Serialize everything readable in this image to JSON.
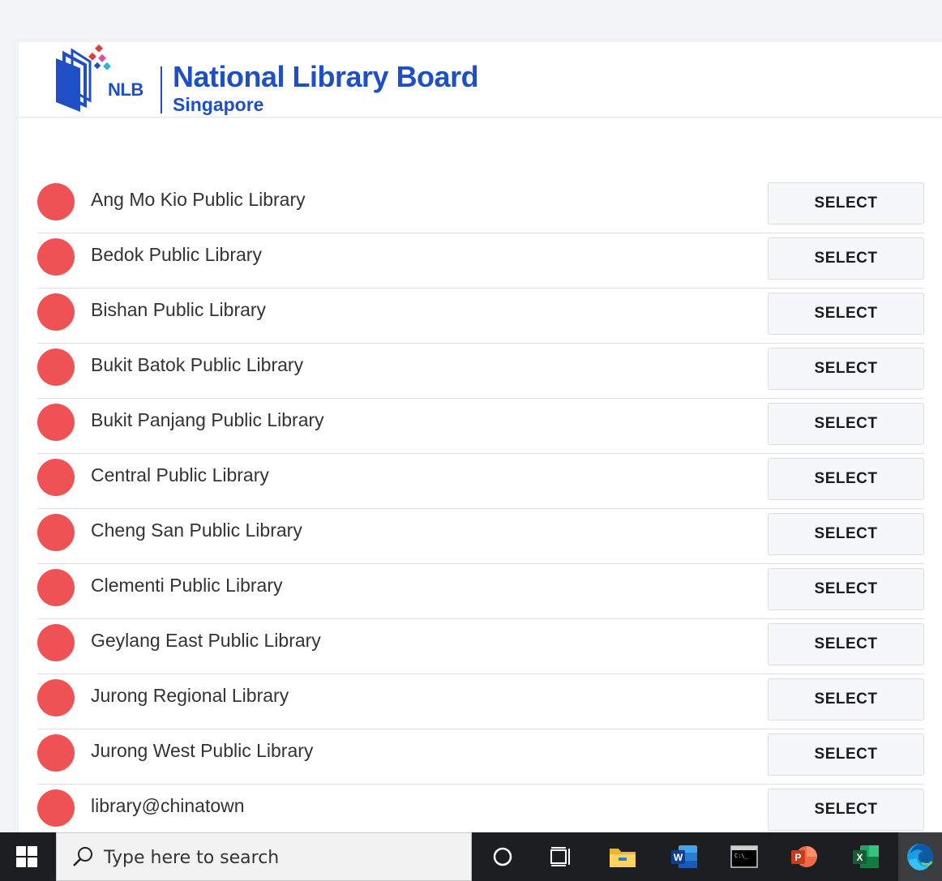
{
  "header": {
    "abbr": "NLB",
    "title": "National Library Board",
    "subtitle": "Singapore"
  },
  "libraries": [
    {
      "name": "Ang Mo Kio Public Library",
      "button": "SELECT"
    },
    {
      "name": "Bedok Public Library",
      "button": "SELECT"
    },
    {
      "name": "Bishan Public Library",
      "button": "SELECT"
    },
    {
      "name": "Bukit Batok Public Library",
      "button": "SELECT"
    },
    {
      "name": "Bukit Panjang Public Library",
      "button": "SELECT"
    },
    {
      "name": "Central Public Library",
      "button": "SELECT"
    },
    {
      "name": "Cheng San Public Library",
      "button": "SELECT"
    },
    {
      "name": "Clementi Public Library",
      "button": "SELECT"
    },
    {
      "name": "Geylang East Public Library",
      "button": "SELECT"
    },
    {
      "name": "Jurong Regional Library",
      "button": "SELECT"
    },
    {
      "name": "Jurong West Public Library",
      "button": "SELECT"
    },
    {
      "name": "library@chinatown",
      "button": "SELECT"
    }
  ],
  "colors": {
    "brand": "#1f4fc4",
    "status_dot": "#ef5255"
  },
  "taskbar": {
    "search_placeholder": "Type here to search",
    "icons": [
      "windows-start-icon",
      "search-icon",
      "cortana-icon",
      "task-view-icon",
      "file-explorer-icon",
      "word-icon",
      "command-prompt-icon",
      "powerpoint-icon",
      "excel-icon",
      "edge-icon"
    ]
  }
}
